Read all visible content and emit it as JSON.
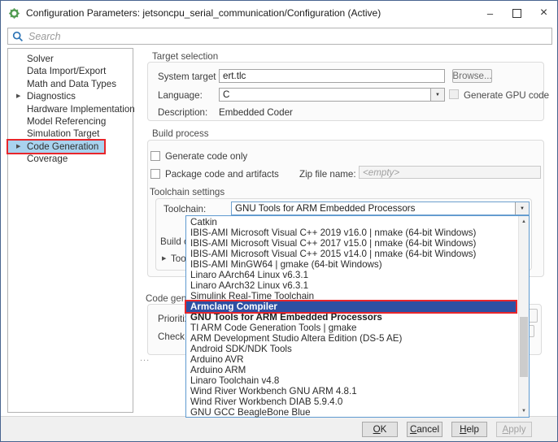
{
  "window": {
    "title": "Configuration Parameters: jetsoncpu_serial_communication/Configuration (Active)"
  },
  "icons": {
    "app": "gear-icon",
    "minimize": "–",
    "close": "×",
    "expand": "▶",
    "combo_arrow": "▼",
    "scroll_up": "▲",
    "scroll_down": "▼"
  },
  "search": {
    "placeholder": "Search"
  },
  "sidebar": {
    "items": [
      {
        "label": "Solver"
      },
      {
        "label": "Data Import/Export"
      },
      {
        "label": "Math and Data Types"
      },
      {
        "label": "Diagnostics",
        "expandable": true
      },
      {
        "label": "Hardware Implementation"
      },
      {
        "label": "Model Referencing"
      },
      {
        "label": "Simulation Target"
      },
      {
        "label": "Code Generation",
        "expandable": true,
        "selected": true,
        "annotated": true
      },
      {
        "label": "Coverage"
      }
    ]
  },
  "target_selection": {
    "group_title": "Target selection",
    "system_target_file": {
      "label": "System target file:",
      "value": "ert.tlc"
    },
    "browse_button": "Browse...",
    "language": {
      "label": "Language:",
      "value": "C"
    },
    "generate_gpu_code_label": "Generate GPU code",
    "description": {
      "label": "Description:",
      "value": "Embedded Coder"
    }
  },
  "build_process": {
    "group_title": "Build process",
    "generate_code_only_label": "Generate code only",
    "package_code_label": "Package code and artifacts",
    "zip_file": {
      "label": "Zip file name:",
      "value": "<empty>"
    },
    "toolchain_settings_title": "Toolchain settings",
    "toolchain": {
      "label": "Toolchain:",
      "value": "GNU Tools for ARM Embedded Processors"
    },
    "obscured_fragments": {
      "build_configuration": "Build c",
      "toolchain_details": "Toolc"
    }
  },
  "code_generation_objectives": {
    "group_title_fragment": "Code gene",
    "prioritized_fragment": "Prioritize",
    "check_model_fragment": "Check m",
    "ellipsis": "..."
  },
  "toolchain_dropdown": {
    "items": [
      {
        "label": "Catkin"
      },
      {
        "label": "IBIS-AMI Microsoft Visual C++ 2019 v16.0 | nmake (64-bit Windows)"
      },
      {
        "label": "IBIS-AMI Microsoft Visual C++ 2017 v15.0 | nmake (64-bit Windows)"
      },
      {
        "label": "IBIS-AMI Microsoft Visual C++ 2015 v14.0 | nmake (64-bit Windows)"
      },
      {
        "label": "IBIS-AMI MinGW64 | gmake (64-bit Windows)"
      },
      {
        "label": "Linaro AArch64 Linux v6.3.1"
      },
      {
        "label": "Linaro AArch32 Linux v6.3.1"
      },
      {
        "label": "Simulink Real-Time Toolchain"
      },
      {
        "label": "Armclang Compiler",
        "selected": true,
        "annotated": true
      },
      {
        "label": "GNU Tools for ARM Embedded Processors",
        "bold": true
      },
      {
        "label": "TI ARM Code Generation Tools | gmake"
      },
      {
        "label": "ARM Development Studio Altera Edition (DS-5 AE)"
      },
      {
        "label": "Android SDK/NDK Tools"
      },
      {
        "label": "Arduino AVR"
      },
      {
        "label": "Arduino ARM"
      },
      {
        "label": "Linaro Toolchain v4.8"
      },
      {
        "label": "Wind River Workbench GNU ARM 4.8.1"
      },
      {
        "label": "Wind River Workbench DIAB 5.9.4.0"
      },
      {
        "label": "GNU GCC BeagleBone Blue"
      }
    ]
  },
  "footer": {
    "buttons": [
      {
        "label": "OK",
        "enabled": true
      },
      {
        "label": "Cancel",
        "enabled": true
      },
      {
        "label": "Help",
        "enabled": true
      },
      {
        "label": "Apply",
        "enabled": false
      }
    ]
  },
  "colors": {
    "selection_blue": "#2d50a3",
    "annotation_red": "#e8262b",
    "sidebar_selection": "#a9d3ef",
    "search_icon_blue": "#2e75b6",
    "app_icon_green": "#4f9a4f"
  }
}
